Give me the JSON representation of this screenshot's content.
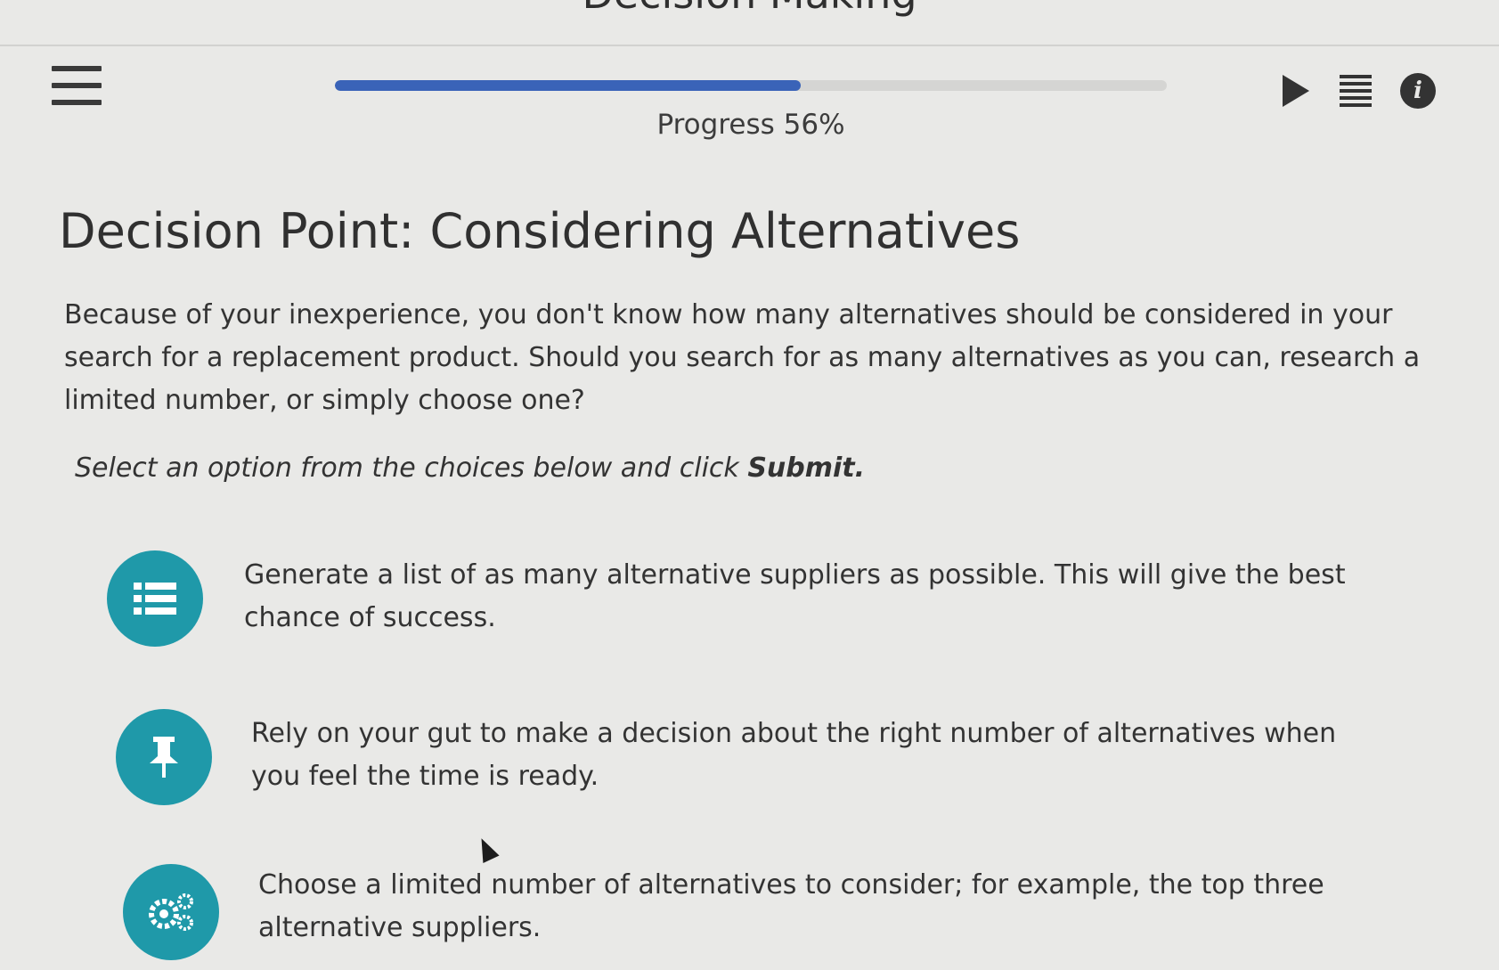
{
  "header": {
    "title": "Decision Making"
  },
  "toolbar": {
    "menu_icon": "hamburger-icon",
    "play_icon": "play-icon",
    "transcript_icon": "list-lines-icon",
    "info_icon": "info-icon",
    "info_glyph": "i"
  },
  "progress": {
    "label": "Progress 56%",
    "percent": 56,
    "fill_color": "#3a63b8"
  },
  "main": {
    "heading": "Decision Point: Considering Alternatives",
    "intro": "Because of your inexperience, you don't know how many alternatives should be considered in your search for a replacement product. Should you search for as many alternatives as you can, research a limited number, or simply choose one?",
    "instruction_prefix": "Select an option from the choices below and click ",
    "instruction_bold": "Submit.",
    "accent_color": "#1f99a9"
  },
  "options": [
    {
      "icon": "list-icon",
      "text": "Generate a list of as many alternative suppliers as possible. This will give the best chance of success."
    },
    {
      "icon": "pushpin-icon",
      "text": "Rely on your gut to make a decision about the right number of alternatives when you feel the time is ready."
    },
    {
      "icon": "gears-icon",
      "text": "Choose a limited number of alternatives to consider; for example, the top three alternative suppliers."
    }
  ]
}
